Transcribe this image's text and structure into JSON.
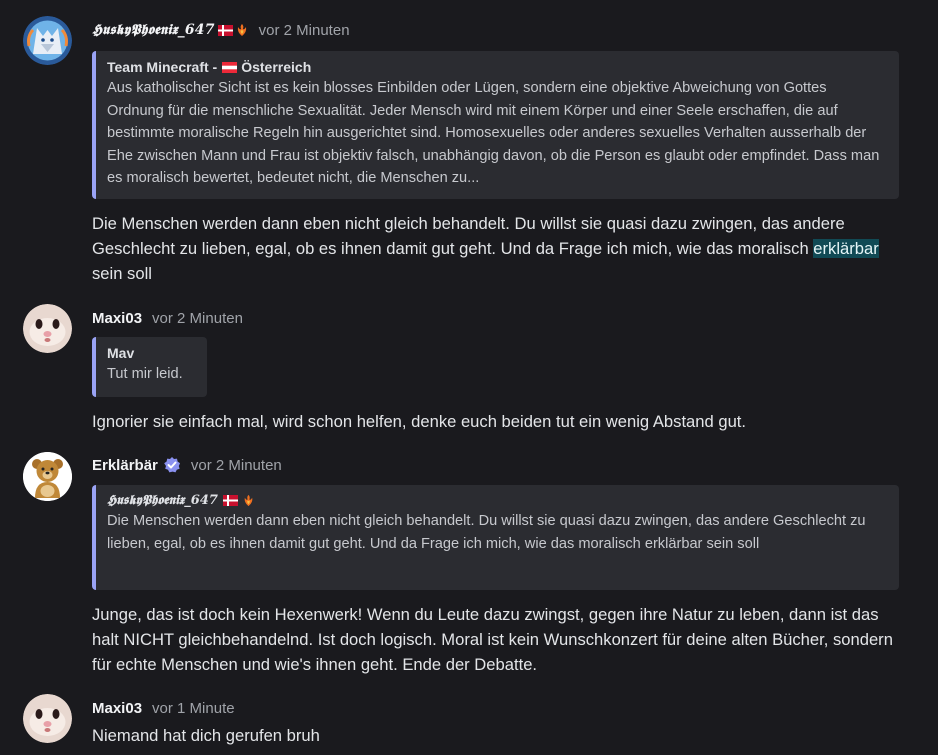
{
  "messages": [
    {
      "author": "𝕳𝖚𝖘𝖐𝖞𝕻𝖍𝖔𝖊𝖓𝖎𝖝_647",
      "time": "vor 2 Minuten",
      "reply": {
        "author": "Team Minecraft -",
        "author_suffix": "Österreich",
        "text": "Aus katholischer Sicht ist es kein blosses Einbilden oder Lügen, sondern eine objektive Abweichung von Gottes Ordnung für die menschliche Sexualität. Jeder Mensch wird mit einem Körper und einer Seele erschaffen, die auf bestimmte moralische Regeln hin ausgerichtet sind. Homosexuelles oder anderes sexuelles Verhalten ausserhalb der Ehe zwischen Mann und Frau ist objektiv falsch, unabhängig davon, ob die Person es glaubt oder empfindet. Dass man es moralisch bewertet, bedeutet nicht, die Menschen zu..."
      },
      "text_before": "Die Menschen werden dann eben nicht gleich behandelt. Du willst sie quasi dazu zwingen, das andere Geschlecht zu lieben, egal, ob es ihnen damit gut geht. Und da Frage ich mich, wie das moralisch ",
      "text_highlight": "erklärbar",
      "text_after": " sein soll"
    },
    {
      "author": "Maxi03",
      "time": "vor 2 Minuten",
      "reply": {
        "author": "Mav",
        "text": "Tut mir leid."
      },
      "text": "Ignorier sie einfach mal, wird schon helfen, denke euch beiden tut ein wenig Abstand gut."
    },
    {
      "author": "Erklärbär",
      "time": "vor 2 Minuten",
      "reply": {
        "author": "𝕳𝖚𝖘𝖐𝖞𝕻𝖍𝖔𝖊𝖓𝖎𝖝_647",
        "text": "Die Menschen werden dann eben nicht gleich behandelt. Du willst sie quasi dazu zwingen, das andere Geschlecht zu lieben, egal, ob es ihnen damit gut geht. Und da Frage ich mich, wie das moralisch erklärbar sein soll"
      },
      "text": "Junge, das ist doch kein Hexenwerk! Wenn du Leute dazu zwingst, gegen ihre Natur zu leben, dann ist das halt NICHT gleichbehandelnd. Ist doch logisch. Moral ist kein Wunschkonzert für deine alten Bücher, sondern für echte Menschen und wie's ihnen geht. Ende der Debatte."
    },
    {
      "author": "Maxi03",
      "time": "vor 1 Minute",
      "text": "Niemand hat dich gerufen bruh"
    }
  ],
  "colors": {
    "background": "#1a1a1e",
    "quote_bar": "#9aa3f5",
    "highlight": "#114a55",
    "verified": "#8a91f0"
  }
}
